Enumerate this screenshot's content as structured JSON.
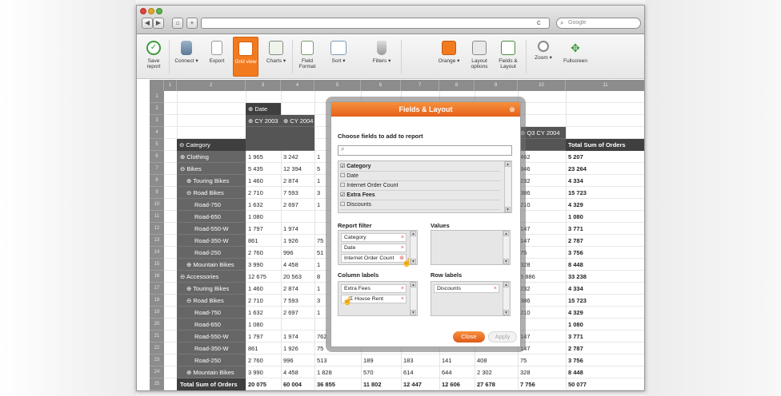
{
  "browser": {
    "search_placeholder": "Google",
    "nav_back": "◀",
    "nav_forward": "▶",
    "nav_home": "⌂",
    "nav_add": "+",
    "reload": "c"
  },
  "toolbar": {
    "save_report": "Save report",
    "connect": "Connect ▾",
    "export": "Export",
    "grid_view": "Grid view",
    "charts": "Charts ▾",
    "field_format": "Field Format",
    "sort": "Sort ▾",
    "filters": "Filters ▾",
    "theme": "Orange ▾",
    "layout_options": "Layout options",
    "fields_layout": "Fields & Layout",
    "zoom": "Zoom ▾",
    "fullscreen": "Fullscreen"
  },
  "colors": {
    "accent": "#f37b1f",
    "dark_header": "#555555",
    "grid_header": "#8c8c8c"
  },
  "grid": {
    "column_numbers": [
      "1",
      "2",
      "3",
      "4",
      "5",
      "6",
      "7",
      "8",
      "9",
      "10",
      "11"
    ],
    "row_numbers": [
      "1",
      "2",
      "3",
      "4",
      "5",
      "6",
      "7",
      "8",
      "9",
      "10",
      "11",
      "12",
      "13",
      "14",
      "15",
      "16",
      "17",
      "18",
      "19",
      "20",
      "21",
      "22",
      "23",
      "24",
      "25"
    ],
    "date_label": "⊕ Date",
    "cy2003_label": "⊕ CY 2003",
    "cy2004_label": "⊕ CY 2004",
    "q3_label": "⊕ Q3 CY 2004",
    "total_sum_header": "Total Sum of Orders",
    "category_label": "⊖ Category",
    "rows": [
      {
        "label": "⊕ Clothing",
        "c3": "1 965",
        "c4": "3 242",
        "c5": "1",
        "c10": "462",
        "c11": "5 207"
      },
      {
        "label": "⊖ Bikes",
        "c3": "5 435",
        "c4": "12 394",
        "c5": "5",
        "c10": "946",
        "c11": "23 264"
      },
      {
        "label": "⊕ Touring Bikes",
        "c3": "1 460",
        "c4": "2 874",
        "c5": "1",
        "c10": "232",
        "c11": "4 334"
      },
      {
        "label": "⊖ Road Bikes",
        "c3": "2 710",
        "c4": "7 593",
        "c5": "3",
        "c10": "386",
        "c11": "15 723"
      },
      {
        "label": "Road-750",
        "c3": "1 632",
        "c4": "2 697",
        "c5": "1",
        "c10": "210",
        "c11": "4 329"
      },
      {
        "label": "Road-650",
        "c3": "1 080",
        "c4": "",
        "c5": "",
        "c10": "",
        "c11": "1 080"
      },
      {
        "label": "Road-550-W",
        "c3": "1 797",
        "c4": "1 974",
        "c5": "",
        "c10": "147",
        "c11": "3 771"
      },
      {
        "label": "Road-350-W",
        "c3": "861",
        "c4": "1 926",
        "c5": "75",
        "c10": "147",
        "c11": "2 787"
      },
      {
        "label": "Road-250",
        "c3": "2 760",
        "c4": "996",
        "c5": "51",
        "c10": "75",
        "c11": "3 756"
      },
      {
        "label": "⊕ Mountain Bikes",
        "c3": "3 990",
        "c4": "4 458",
        "c5": "1",
        "c10": "328",
        "c11": "8 448"
      },
      {
        "label": "⊖ Accessories",
        "c3": "12 675",
        "c4": "20 563",
        "c5": "8",
        "c10": "5 886",
        "c11": "33 238"
      },
      {
        "label": "⊕ Touring Bikes",
        "c3": "1 460",
        "c4": "2 874",
        "c5": "1",
        "c10": "232",
        "c11": "4 334"
      },
      {
        "label": "⊖ Road Bikes",
        "c3": "2 710",
        "c4": "7 593",
        "c5": "3",
        "c10": "386",
        "c11": "15 723"
      },
      {
        "label": "Road-750",
        "c3": "1 632",
        "c4": "2 697",
        "c5": "1",
        "c10": "210",
        "c11": "4 329"
      },
      {
        "label": "Road-650",
        "c3": "1 080",
        "c4": "",
        "c5": "",
        "c10": "",
        "c11": "1 080"
      },
      {
        "label": "Road-550-W",
        "c3": "1 797",
        "c4": "1 974",
        "c5": "762",
        "c10": "147",
        "c11": "3 771"
      },
      {
        "label": "Road-350-W",
        "c3": "861",
        "c4": "1 926",
        "c5": "75",
        "c10": "147",
        "c11": "2 787"
      }
    ],
    "row23": {
      "label": "Road-250",
      "c3": "2 760",
      "c4": "996",
      "c5": "513",
      "c6": "189",
      "c7": "183",
      "c8": "141",
      "c9": "408",
      "c10": "75",
      "c11": "3 756"
    },
    "row24": {
      "label": "⊕ Mountain Bikes",
      "c3": "3 990",
      "c4": "4 458",
      "c5": "1 828",
      "c6": "570",
      "c7": "614",
      "c8": "644",
      "c9": "2 302",
      "c10": "328",
      "c11": "8 448"
    },
    "row25": {
      "label": "Total Sum of Orders",
      "c3": "20 075",
      "c4": "60 004",
      "c5": "36 855",
      "c6": "11 802",
      "c7": "12 447",
      "c8": "12 606",
      "c9": "27 678",
      "c10": "7 756",
      "c11": "50 077"
    }
  },
  "dialog": {
    "title": "Fields & Layout",
    "close_icon": "⊗",
    "choose_fields": "Choose fields to add to report",
    "fields": [
      {
        "label": "Category",
        "checked": "☑"
      },
      {
        "label": "Date",
        "checked": "☐"
      },
      {
        "label": "Internet Order Count",
        "checked": "☐"
      },
      {
        "label": "Extra Fees",
        "checked": "☑"
      },
      {
        "label": "Discounts",
        "checked": "☐"
      }
    ],
    "report_filter": "Report filter",
    "values": "Values",
    "column_labels": "Column labels",
    "row_labels": "Row labels",
    "report_filter_items": [
      "Category",
      "Date",
      "Internet Order Count"
    ],
    "column_label_items": [
      "Extra Fees",
      "Σ House Rent"
    ],
    "row_label_items": [
      "Discounts"
    ],
    "close_button": "Close",
    "apply_button": "Apply"
  }
}
